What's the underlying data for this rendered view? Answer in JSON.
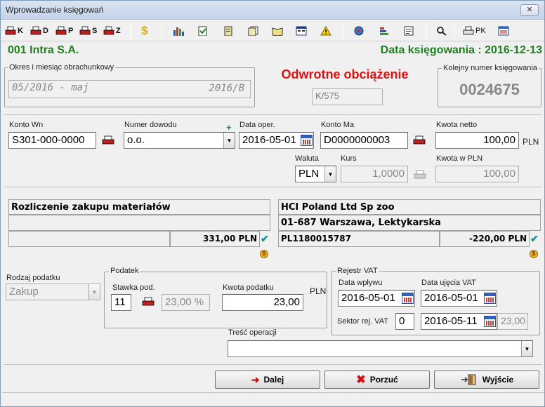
{
  "window": {
    "title": "Wprowadzanie księgowań",
    "close_label": "✕"
  },
  "toolbar": {
    "k_label": "K",
    "d_label": "D",
    "p_label": "P",
    "s_label": "S",
    "z_label": "Z",
    "dollar_label": "$",
    "pk_label": "PK"
  },
  "header": {
    "company": "001 Intra S.A.",
    "posting_date": "Data księgowania : 2016-12-13"
  },
  "period": {
    "label": "Okres i miesiąc obrachunkowy",
    "value": "05/2016 - maj",
    "register": "2016/B"
  },
  "doc_type": {
    "title": "Odwrotne obciążenie",
    "code": "K/575"
  },
  "entry_no": {
    "label": "Kolejny numer księgowania",
    "value": "0024675"
  },
  "form": {
    "konto_wn_label": "Konto Wn",
    "konto_wn": "S301-000-0000",
    "numer_dowodu_label": "Numer dowodu",
    "numer_dowodu": "o.o.",
    "plus": "+",
    "data_oper_label": "Data oper.",
    "data_oper": "2016-05-01",
    "konto_ma_label": "Konto Ma",
    "konto_ma": "D0000000003",
    "kwota_netto_label": "Kwota netto",
    "kwota_netto": "100,00",
    "currency": "PLN",
    "waluta_label": "Waluta",
    "waluta": "PLN",
    "kurs_label": "Kurs",
    "kurs": "1,0000",
    "kwota_pln_label": "Kwota w PLN",
    "kwota_pln": "100,00"
  },
  "left_account": {
    "name": "Rozliczenie zakupu materiałów",
    "line2": "",
    "amount": "331,00 PLN"
  },
  "right_account": {
    "name": "HCI Poland Ltd Sp zoo",
    "address": "01-687 Warszawa, Lektykarska",
    "nip": "PL1180015787",
    "amount": "-220,00 PLN"
  },
  "tax": {
    "rodzaj_label": "Rodzaj podatku",
    "rodzaj": "Zakup",
    "group_label": "Podatek",
    "stawka_label": "Stawka pod.",
    "stawka": "11",
    "stawka_pct": "23,00 %",
    "kwota_label": "Kwota podatku",
    "kwota": "23,00",
    "pln": "PLN"
  },
  "vat": {
    "group_label": "Rejestr VAT",
    "data_wplywu_label": "Data wpływu",
    "data_wplywu": "2016-05-01",
    "data_ujecia_label": "Data ujęcia VAT",
    "data_ujecia": "2016-05-01",
    "sektor_label": "Sektor rej. VAT",
    "sektor": "0",
    "sektor_date": "2016-05-11",
    "sektor_amount": "23,00"
  },
  "tresc": {
    "label": "Treść operacji",
    "value": ""
  },
  "buttons": {
    "dalej": "Dalej",
    "porzuc": "Porzuć",
    "wyjscie": "Wyjście"
  }
}
